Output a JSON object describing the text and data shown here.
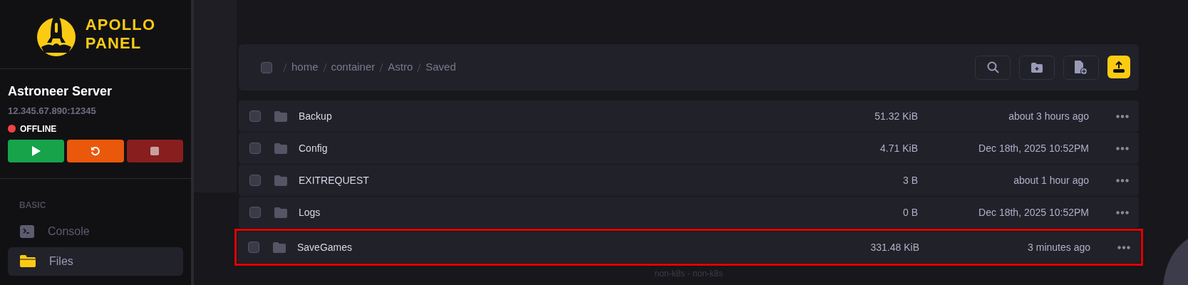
{
  "logo": {
    "line_1": "APOLLO",
    "line_2": "PANEL"
  },
  "server": {
    "name": "Astroneer Server",
    "address": "12.345.67.890:12345",
    "status": "OFFLINE",
    "online": false
  },
  "power_buttons": [
    {
      "kind": "start"
    },
    {
      "kind": "restart"
    },
    {
      "kind": "stop"
    }
  ],
  "nav": {
    "section": "BASIC",
    "items": [
      {
        "label": "Console",
        "kind": "terminal",
        "selected": false
      },
      {
        "label": "Files",
        "kind": "folder",
        "selected": true
      }
    ]
  },
  "breadcrumb": {
    "checked": false,
    "parts": [
      "home",
      "container",
      "Astro",
      "Saved"
    ]
  },
  "toolbar": [
    {
      "kind": "search"
    },
    {
      "kind": "new-folder"
    },
    {
      "kind": "new-file"
    },
    {
      "kind": "upload"
    }
  ],
  "files": [
    {
      "name": "Backup",
      "size": "51.32 KiB",
      "modified": "about 3 hours ago",
      "checked": false,
      "highlighted": false
    },
    {
      "name": "Config",
      "size": "4.71 KiB",
      "modified": "Dec 18th, 2025 10:52PM",
      "checked": false,
      "highlighted": false
    },
    {
      "name": "EXITREQUEST",
      "size": "3 B",
      "modified": "about 1 hour ago",
      "checked": false,
      "highlighted": false
    },
    {
      "name": "Logs",
      "size": "0 B",
      "modified": "Dec 18th, 2025 10:52PM",
      "checked": false,
      "highlighted": false
    },
    {
      "name": "SaveGames",
      "size": "331.48 KiB",
      "modified": "3 minutes ago",
      "checked": false,
      "highlighted": true
    }
  ],
  "footer": "non-k8s - non-k8s"
}
